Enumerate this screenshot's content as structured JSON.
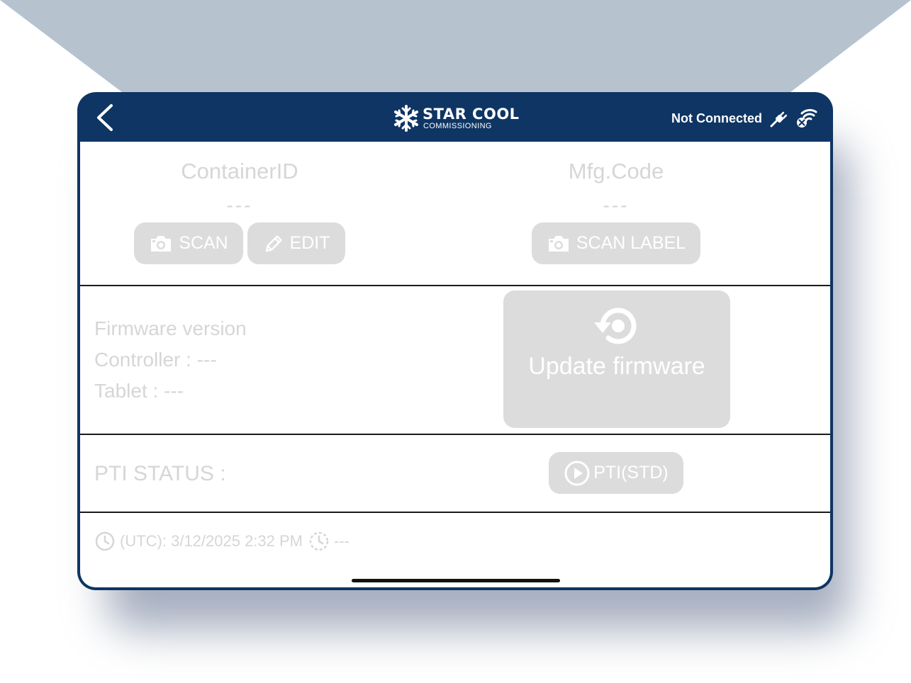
{
  "header": {
    "brand_title": "STAR COOL",
    "brand_subtitle": "COMMISSIONING",
    "connection_status": "Not Connected"
  },
  "identity": {
    "container_label": "ContainerID",
    "container_value": "---",
    "mfg_label": "Mfg.Code",
    "mfg_value": "---",
    "scan_label": "SCAN",
    "edit_label": "EDIT",
    "scan_label_button": "SCAN LABEL"
  },
  "firmware": {
    "heading": "Firmware version",
    "controller": "Controller : ---",
    "tablet": "Tablet : ---",
    "update_label": "Update firmware"
  },
  "pti": {
    "status_label": "PTI STATUS :",
    "button_label": "PTI(STD)"
  },
  "footer": {
    "utc_time": "(UTC): 3/12/2025 2:32 PM",
    "duration": "---"
  },
  "colors": {
    "header_bg": "#0e3563",
    "backdrop": "#b6c3cf",
    "disabled_button": "#dcdcdc",
    "disabled_text": "#d6d6d6"
  },
  "icons": [
    "chevron-left-icon",
    "snowflake-icon",
    "plug-icon",
    "wifi-off-icon",
    "camera-icon",
    "pencil-icon",
    "refresh-icon",
    "play-circle-icon",
    "clock-icon",
    "timer-icon"
  ]
}
